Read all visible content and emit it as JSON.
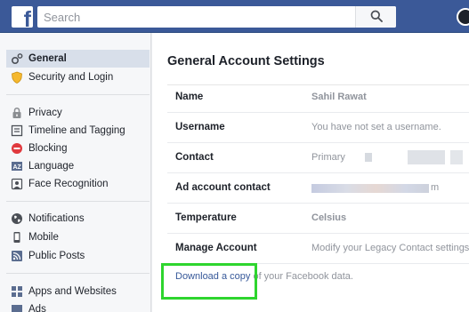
{
  "topbar": {
    "logo_letter": "f",
    "search": {
      "placeholder": "Search",
      "value": ""
    }
  },
  "sidebar": {
    "groups": [
      [
        {
          "label": "General",
          "icon": "gear-icon",
          "active": true
        },
        {
          "label": "Security and Login",
          "icon": "shield-icon"
        }
      ],
      [
        {
          "label": "Privacy",
          "icon": "lock-icon"
        },
        {
          "label": "Timeline and Tagging",
          "icon": "timeline-icon"
        },
        {
          "label": "Blocking",
          "icon": "block-icon"
        },
        {
          "label": "Language",
          "icon": "language-icon"
        },
        {
          "label": "Face Recognition",
          "icon": "face-recognition-icon"
        }
      ],
      [
        {
          "label": "Notifications",
          "icon": "globe-icon"
        },
        {
          "label": "Mobile",
          "icon": "mobile-icon"
        },
        {
          "label": "Public Posts",
          "icon": "rss-icon"
        }
      ],
      [
        {
          "label": "Apps and Websites",
          "icon": "apps-icon"
        },
        {
          "label": "Ads",
          "icon": "ads-icon"
        }
      ]
    ]
  },
  "main": {
    "title": "General Account Settings",
    "rows": [
      {
        "label": "Name",
        "value": "Sahil Rawat"
      },
      {
        "label": "Username",
        "value": "You have not set a username."
      },
      {
        "label": "Contact",
        "value": "Primary"
      },
      {
        "label": "Ad account contact",
        "value": "m"
      },
      {
        "label": "Temperature",
        "value": "Celsius"
      },
      {
        "label": "Manage Account",
        "value": "Modify your Legacy Contact settings"
      }
    ],
    "download": {
      "link": "Download a copy",
      "rest": " of your Facebook data."
    }
  },
  "colors": {
    "brand": "#3b5998",
    "link": "#365899",
    "highlight": "#2ed52e",
    "sidebar_active": "#d8dfea"
  }
}
